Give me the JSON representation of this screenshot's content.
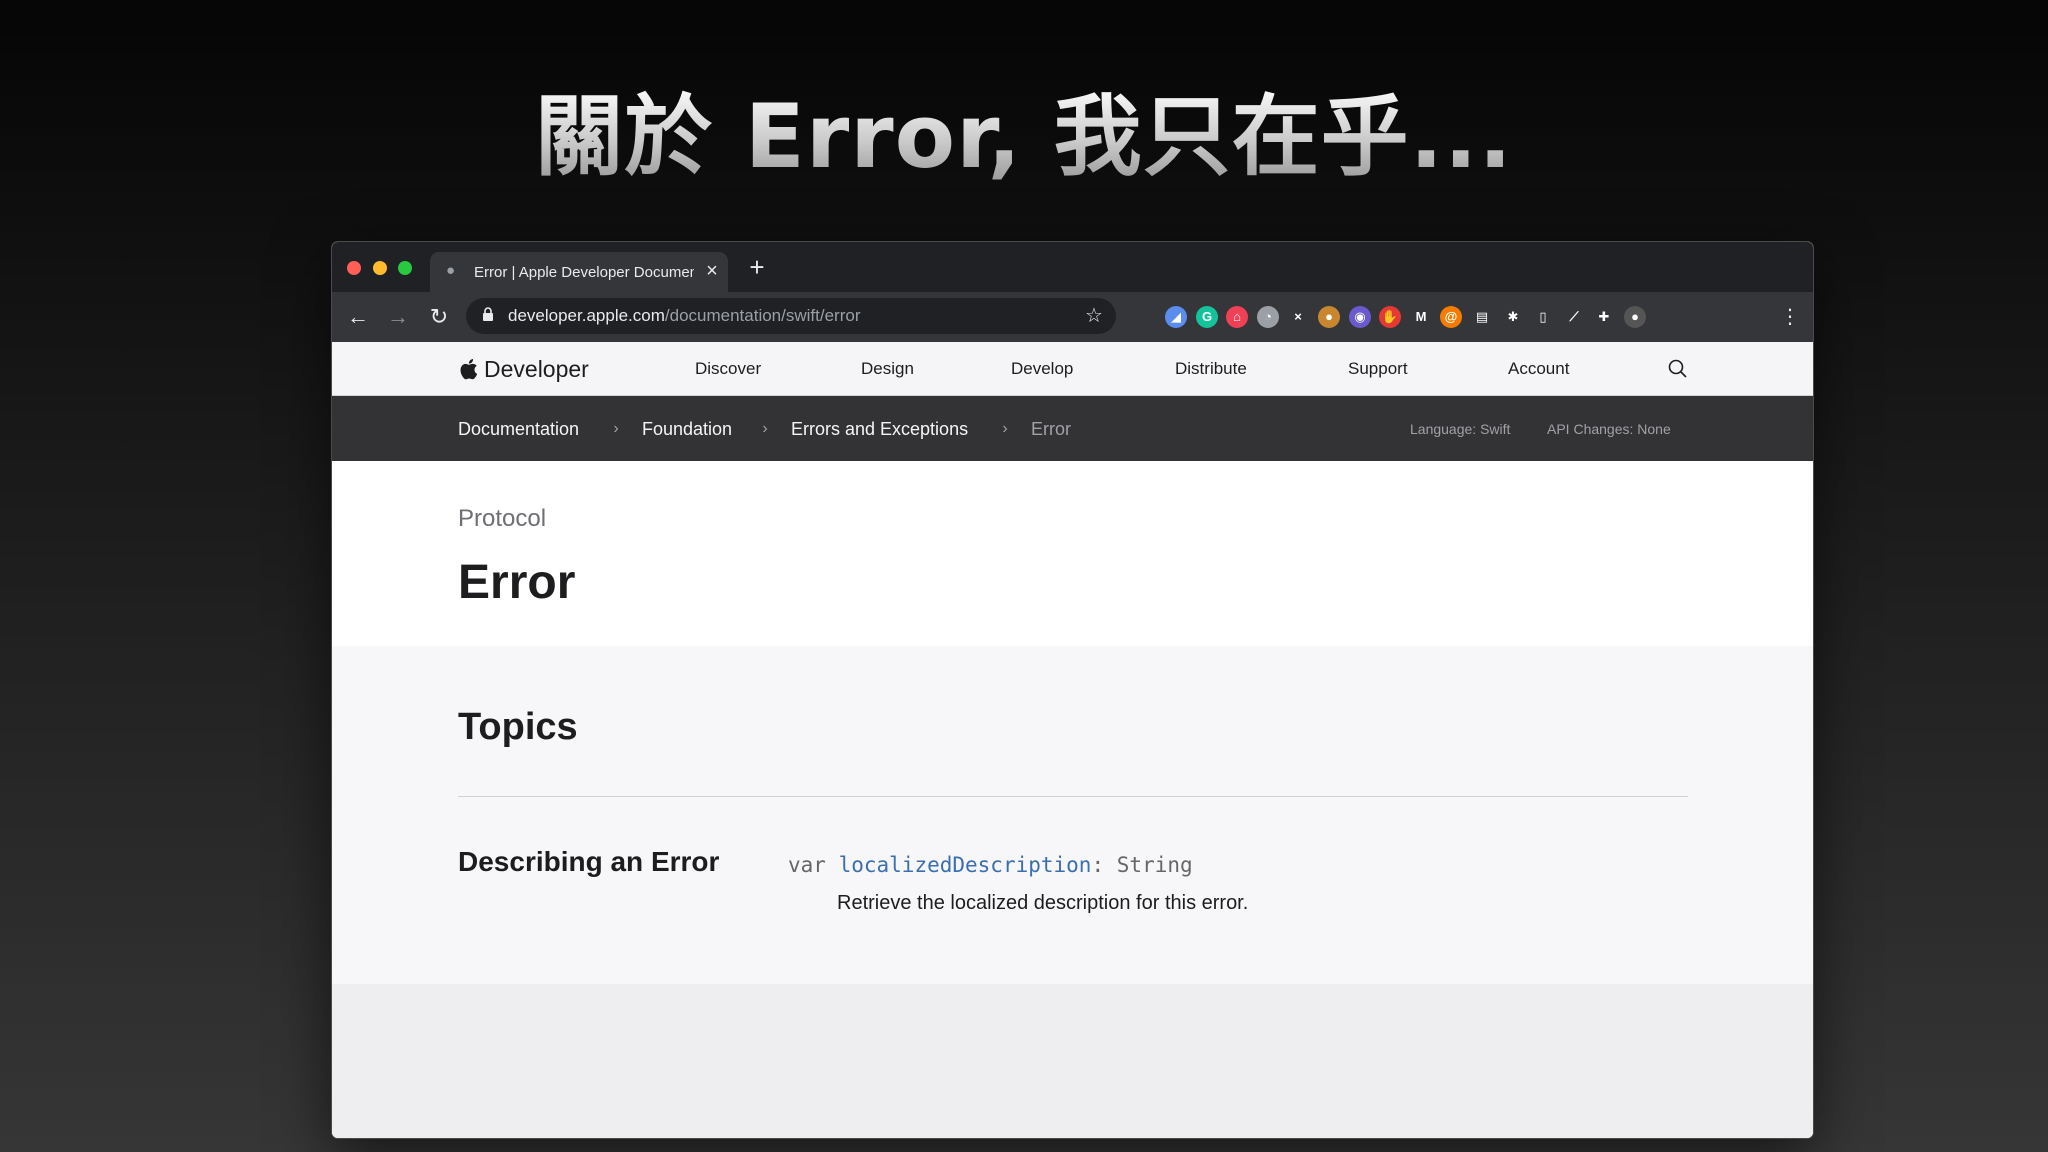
{
  "slide": {
    "title": "關於 Error, 我只在乎..."
  },
  "browser": {
    "tab": {
      "title": "Error | Apple Developer Documentation"
    },
    "url": {
      "host": "developer.apple.com",
      "path": "/documentation/swift/error"
    },
    "extensions": [
      {
        "icon": "compass-icon",
        "color": "#5b8def",
        "glyph": "◢"
      },
      {
        "icon": "grammarly-icon",
        "color": "#15c39a",
        "glyph": "G"
      },
      {
        "icon": "pocket-icon",
        "color": "#ef4056",
        "glyph": "⌂"
      },
      {
        "icon": "mouse-icon",
        "color": "#9aa0a6",
        "glyph": "◔"
      },
      {
        "icon": "x-icon",
        "color": "#35363a",
        "glyph": "×"
      },
      {
        "icon": "cookie-icon",
        "color": "#c8872e",
        "glyph": "●"
      },
      {
        "icon": "translate-icon",
        "color": "#6a5acd",
        "glyph": "◉"
      },
      {
        "icon": "hand-icon",
        "color": "#e53935",
        "glyph": "✋"
      },
      {
        "icon": "mcp-icon",
        "color": "#35363a",
        "glyph": "M"
      },
      {
        "icon": "spiral-icon",
        "color": "#f57c00",
        "glyph": "@"
      },
      {
        "icon": "document-icon",
        "color": "#35363a",
        "glyph": "▤"
      },
      {
        "icon": "asterisk-icon",
        "color": "#35363a",
        "glyph": "✱"
      },
      {
        "icon": "page-icon",
        "color": "#35363a",
        "glyph": "▯"
      },
      {
        "icon": "feather-icon",
        "color": "#35363a",
        "glyph": "⟋"
      },
      {
        "icon": "puzzle-icon",
        "color": "#35363a",
        "glyph": "✚"
      },
      {
        "icon": "avatar-icon",
        "color": "#555555",
        "glyph": "●"
      }
    ]
  },
  "globalnav": {
    "brand": "Developer",
    "items": [
      "Discover",
      "Design",
      "Develop",
      "Distribute",
      "Support",
      "Account"
    ]
  },
  "breadcrumbs": {
    "items": [
      "Documentation",
      "Foundation",
      "Errors and Exceptions",
      "Error"
    ],
    "separator": "›",
    "language": "Language: Swift",
    "api_changes": "API Changes:  None"
  },
  "doc": {
    "eyebrow": "Protocol",
    "title": "Error",
    "topics_title": "Topics",
    "group_title": "Describing an Error",
    "declaration": {
      "keyword": "var",
      "symbol": "localizedDescription",
      "colon": ":",
      "type": "String"
    },
    "abstract": "Retrieve the localized description for this error."
  },
  "colors": {
    "link": "#3a6fb0",
    "tabstrip": "#202124",
    "toolbar": "#35363a",
    "localnav": "#333336"
  }
}
